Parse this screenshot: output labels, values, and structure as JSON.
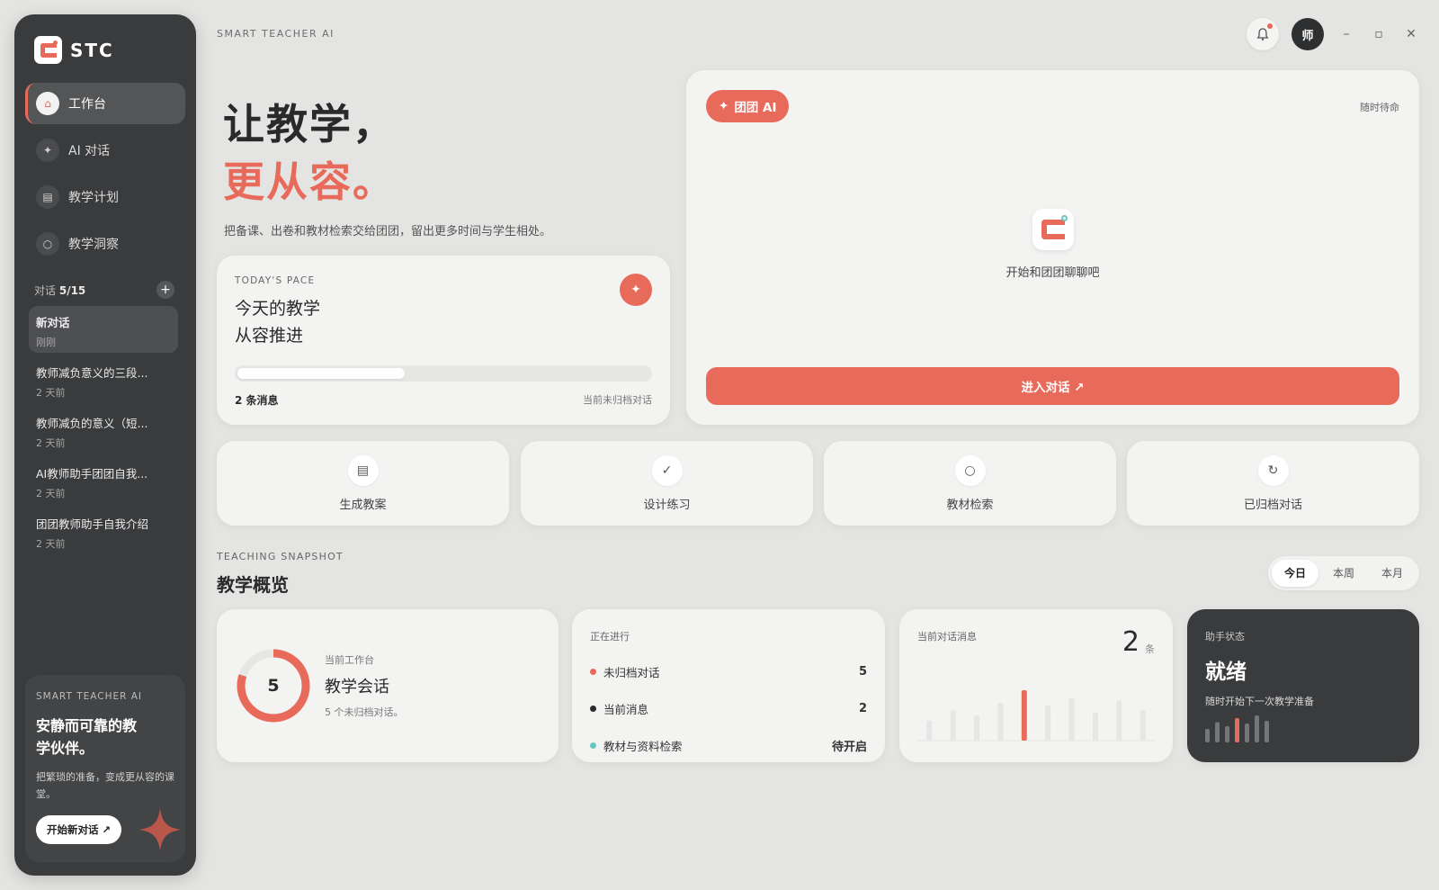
{
  "sidebar": {
    "brand": "STC",
    "nav": [
      {
        "label": "工作台",
        "icon": "home-icon"
      },
      {
        "label": "AI 对话",
        "icon": "sparkle-icon"
      },
      {
        "label": "教学计划",
        "icon": "document-icon"
      },
      {
        "label": "教学洞察",
        "icon": "insight-icon"
      }
    ],
    "conversations_label": "对话",
    "conversations_count": "5/15",
    "conversations": [
      {
        "title": "新对话",
        "time": "刚刚"
      },
      {
        "title": "教师减负意义的三段...",
        "time": "2 天前"
      },
      {
        "title": "教师减负的意义（短...",
        "time": "2 天前"
      },
      {
        "title": "AI教师助手团团自我...",
        "time": "2 天前"
      },
      {
        "title": "团团教师助手自我介绍",
        "time": "2 天前"
      }
    ],
    "promo": {
      "kicker": "SMART TEACHER AI",
      "title": "安静而可靠的教学伙伴。",
      "desc": "把繁琐的准备，变成更从容的课堂。",
      "button": "开始新对话 ↗"
    }
  },
  "topbar": {
    "app_title": "SMART TEACHER AI",
    "avatar": "师",
    "minimize": "–",
    "maximize": "▫",
    "close": "✕"
  },
  "hero": {
    "line1": "让教学，",
    "line2": "更从容。",
    "subtitle": "把备课、出卷和教材检索交给团团，留出更多时间与学生相处。"
  },
  "pace": {
    "kicker": "TODAY'S PACE",
    "title_line1": "今天的教学",
    "title_line2": "从容推进",
    "progress": 0.4,
    "messages": "2 条消息",
    "status": "当前未归档对话"
  },
  "chat": {
    "badge": "团团 AI",
    "status": "随时待命",
    "empty_text": "开始和团团聊聊吧",
    "enter_button": "进入对话 ↗"
  },
  "quick_actions": [
    {
      "label": "生成教案",
      "icon": "document-icon",
      "glyph": "▤"
    },
    {
      "label": "设计练习",
      "icon": "check-icon",
      "glyph": "✓"
    },
    {
      "label": "教材检索",
      "icon": "search-icon",
      "glyph": "○"
    },
    {
      "label": "已归档对话",
      "icon": "refresh-icon",
      "glyph": "↻"
    }
  ],
  "snapshot": {
    "kicker": "TEACHING SNAPSHOT",
    "title": "教学概览",
    "ranges": [
      "今日",
      "本周",
      "本月"
    ],
    "active_range": 0,
    "workspace": {
      "count": "5",
      "kicker": "当前工作台",
      "title": "教学会话",
      "desc": "5 个未归档对话。",
      "ring_fraction": 0.8
    },
    "in_progress": {
      "kicker": "正在进行",
      "rows": [
        {
          "label": "未归档对话",
          "value": "5",
          "color": "#e86a5b"
        },
        {
          "label": "当前消息",
          "value": "2",
          "color": "#2a2a2a"
        },
        {
          "label": "教材与资料检索",
          "value": "待开启",
          "color": "#6ac6c0"
        }
      ]
    },
    "messages": {
      "kicker": "当前对话消息",
      "count": "2",
      "unit": "条",
      "bars": [
        0.4,
        0.6,
        0.5,
        0.75,
        1.0,
        0.7,
        0.85,
        0.55,
        0.8,
        0.6
      ],
      "highlight_index": 4
    },
    "assistant": {
      "kicker": "助手状态",
      "title": "就绪",
      "desc": "随时开始下一次教学准备",
      "bars": [
        0.5,
        0.75,
        0.6,
        0.9,
        0.7,
        1.0,
        0.8
      ],
      "highlight_index": 3
    }
  },
  "colors": {
    "accent": "#e86a5b",
    "dark": "#3a3b3d",
    "teal": "#6ac6c0"
  }
}
